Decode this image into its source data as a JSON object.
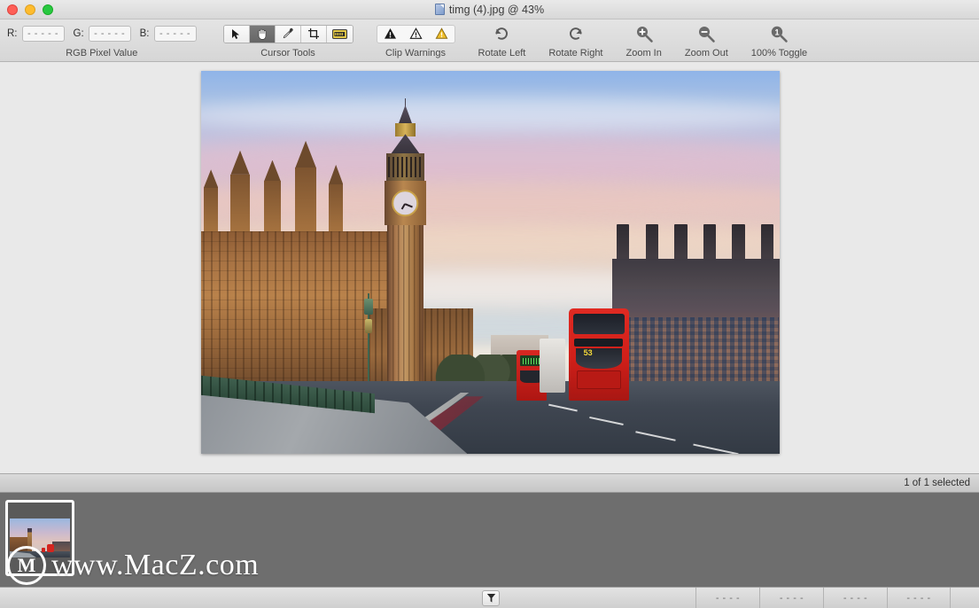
{
  "window": {
    "title": "timg (4).jpg @ 43%",
    "title_icon": "image-document-icon",
    "traffic_lights": [
      "close-button",
      "minimize-button",
      "zoom-button"
    ]
  },
  "toolbar": {
    "rgb_group": {
      "label": "RGB Pixel Value",
      "fields": [
        {
          "label": "R:",
          "value": "- - - - -"
        },
        {
          "label": "G:",
          "value": "- - - - -"
        },
        {
          "label": "B:",
          "value": "- - - - -"
        }
      ]
    },
    "cursor_group": {
      "label": "Cursor Tools",
      "tools": [
        {
          "name": "arrow-tool",
          "icon": "arrow-icon",
          "selected": false
        },
        {
          "name": "hand-tool",
          "icon": "hand-icon",
          "selected": true
        },
        {
          "name": "eyedropper-tool",
          "icon": "eyedropper-icon",
          "selected": false
        },
        {
          "name": "crop-tool",
          "icon": "crop-icon",
          "selected": false
        },
        {
          "name": "measure-tool",
          "icon": "ruler-icon",
          "selected": false
        }
      ]
    },
    "clip_group": {
      "label": "Clip Warnings",
      "buttons": [
        {
          "name": "clip-warning-black",
          "icon": "warning-triangle-filled-icon"
        },
        {
          "name": "clip-warning-outline",
          "icon": "warning-triangle-outline-icon"
        },
        {
          "name": "clip-warning-yellow",
          "icon": "warning-triangle-yellow-icon"
        }
      ]
    },
    "actions": [
      {
        "name": "rotate-left-button",
        "label": "Rotate Left",
        "icon": "rotate-left-icon"
      },
      {
        "name": "rotate-right-button",
        "label": "Rotate Right",
        "icon": "rotate-right-icon"
      },
      {
        "name": "zoom-in-button",
        "label": "Zoom In",
        "icon": "magnifier-plus-icon"
      },
      {
        "name": "zoom-out-button",
        "label": "Zoom Out",
        "icon": "magnifier-minus-icon"
      },
      {
        "name": "zoom-100-button",
        "label": "100% Toggle",
        "icon": "magnifier-one-icon"
      }
    ]
  },
  "photo": {
    "description": "Big Ben and the Palace of Westminster at sunset with red double-decker buses on Westminster Bridge",
    "bus_route_number": "53",
    "colors": {
      "sky_top": "#8fb4e8",
      "sky_pink": "#e2c3c6",
      "sky_peach": "#e7cbc2",
      "stone_warm": "#b9824b",
      "bus_red": "#d4251f",
      "road_dark": "#3f4651",
      "rail_green": "#2d4a3b"
    }
  },
  "status": {
    "selection": "1 of 1 selected"
  },
  "filmstrip": {
    "thumbnails": [
      {
        "name": "thumbnail-timg-4",
        "selected": true
      }
    ]
  },
  "watermark": {
    "logo_letter": "M",
    "text": "www.MacZ.com"
  },
  "bottom_bar": {
    "filter_icon": "funnel-filter-icon",
    "cells": [
      "- - - -",
      "- - - -",
      "- - - -",
      "- - - -"
    ]
  }
}
